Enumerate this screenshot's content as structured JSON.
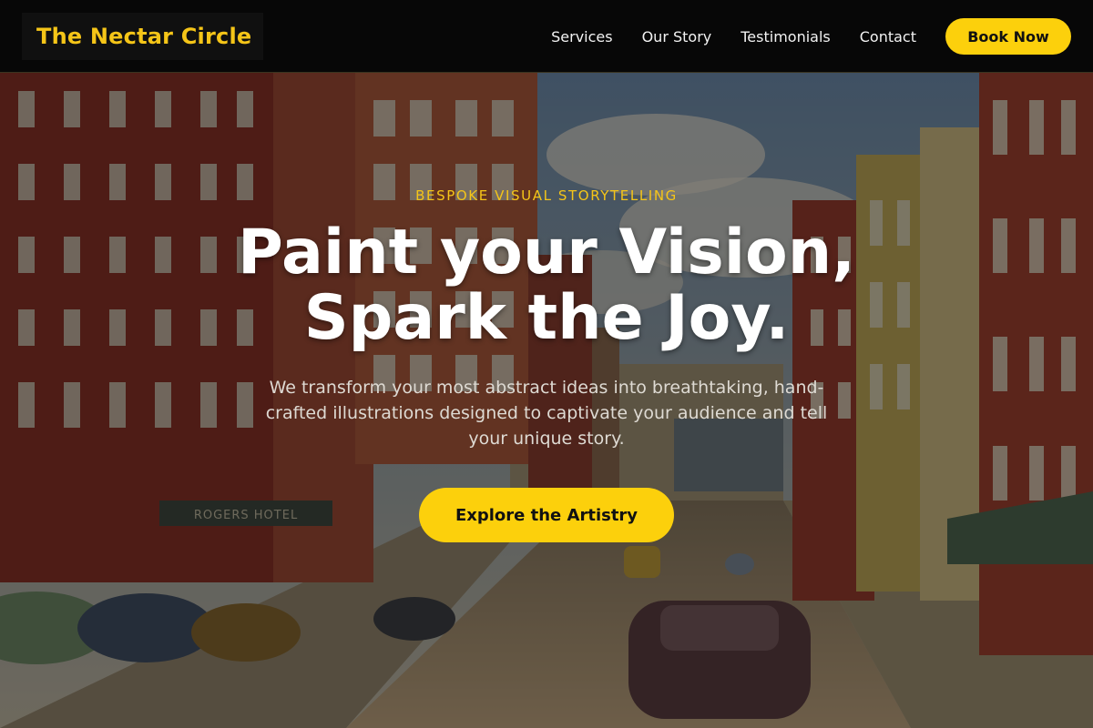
{
  "brand": {
    "name": "The Nectar Circle"
  },
  "nav": {
    "links": [
      "Services",
      "Our Story",
      "Testimonials",
      "Contact"
    ],
    "cta_label": "Book Now"
  },
  "hero": {
    "eyebrow": "BESPOKE VISUAL STORYTELLING",
    "headline_line1": "Paint your Vision,",
    "headline_line2": "Spark the Joy.",
    "subtext": "We transform your most abstract ideas into breathtaking, hand-crafted illustrations designed to captivate your audience and tell your unique story.",
    "cta_label": "Explore the Artistry",
    "background_description_sign": "ROGERS HOTEL"
  },
  "colors": {
    "accent": "#fcd00c",
    "logo": "#f5c518",
    "header_bg": "#070707"
  }
}
